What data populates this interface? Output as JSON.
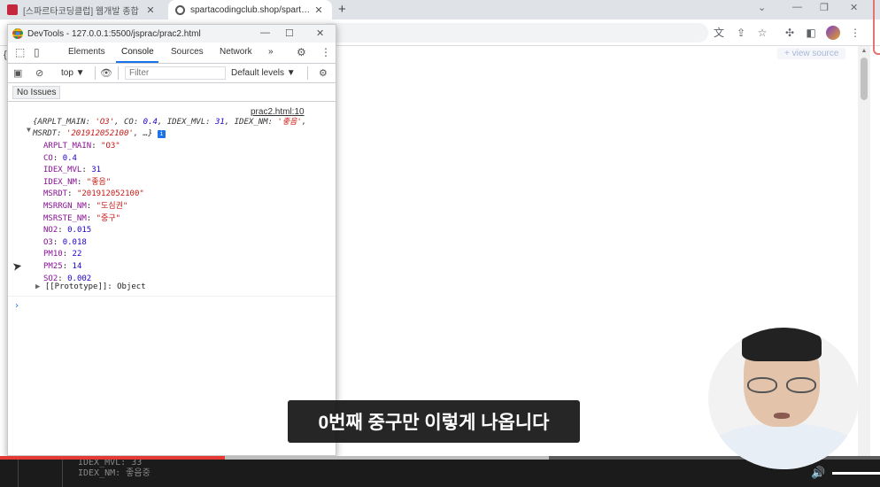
{
  "browser": {
    "tabs": [
      {
        "title": "[스파르타코딩클럽] 웹개발 종합",
        "active": false
      },
      {
        "title": "spartacodingclub.shop/sparta_a",
        "active": true
      }
    ],
    "view_source_label": "+ view source"
  },
  "devtools": {
    "window_title": "DevTools - 127.0.0.1:5500/jsprac/prac2.html",
    "tabs": [
      "Elements",
      "Console",
      "Sources",
      "Network"
    ],
    "active_tab": "Console",
    "more_tabs": "»",
    "context": "top",
    "filter_placeholder": "Filter",
    "levels": "Default levels ▼",
    "issues_button": "No Issues",
    "console": {
      "source_link": "prac2.html:10",
      "summary_line1_html_parts": [
        {
          "k": "{ARPLT_MAIN: "
        },
        {
          "s": "'O3'"
        },
        {
          "k": ", CO: "
        },
        {
          "n": "0.4"
        },
        {
          "k": ", IDEX_MVL: "
        },
        {
          "n": "31"
        },
        {
          "k": ", IDEX_NM: "
        },
        {
          "s": "'좋음'"
        },
        {
          "k": ","
        }
      ],
      "summary_line2_key": "MSRDT: ",
      "summary_line2_value": "'201912052100'",
      "summary_line2_tail": ", …}",
      "info_badge": "i",
      "properties": [
        {
          "key": "ARPLT_MAIN",
          "value": "\"O3\"",
          "type": "string"
        },
        {
          "key": "CO",
          "value": "0.4",
          "type": "number"
        },
        {
          "key": "IDEX_MVL",
          "value": "31",
          "type": "number"
        },
        {
          "key": "IDEX_NM",
          "value": "\"좋음\"",
          "type": "string"
        },
        {
          "key": "MSRDT",
          "value": "\"201912052100\"",
          "type": "string"
        },
        {
          "key": "MSRRGN_NM",
          "value": "\"도심권\"",
          "type": "string"
        },
        {
          "key": "MSRSTE_NM",
          "value": "\"중구\"",
          "type": "string"
        },
        {
          "key": "NO2",
          "value": "0.015",
          "type": "number"
        },
        {
          "key": "O3",
          "value": "0.018",
          "type": "number"
        },
        {
          "key": "PM10",
          "value": "22",
          "type": "number"
        },
        {
          "key": "PM25",
          "value": "14",
          "type": "number"
        },
        {
          "key": "SO2",
          "value": "0.002",
          "type": "number"
        }
      ],
      "prototype": "[[Prototype]]: Object",
      "prompt": "›"
    }
  },
  "video": {
    "subtitle": "0번째 중구만 이렇게 나옵니다",
    "progress_played": 0.256,
    "progress_buffered_end": 0.624,
    "underlying_lines": [
      "IDEX_MVL: 33",
      "IDEX_NM: 좋음중"
    ]
  },
  "colors": {
    "accent": "#1a73e8",
    "string": "#c41a16",
    "number": "#1c00cf",
    "key": "#871094",
    "progress_red": "#e53935"
  }
}
